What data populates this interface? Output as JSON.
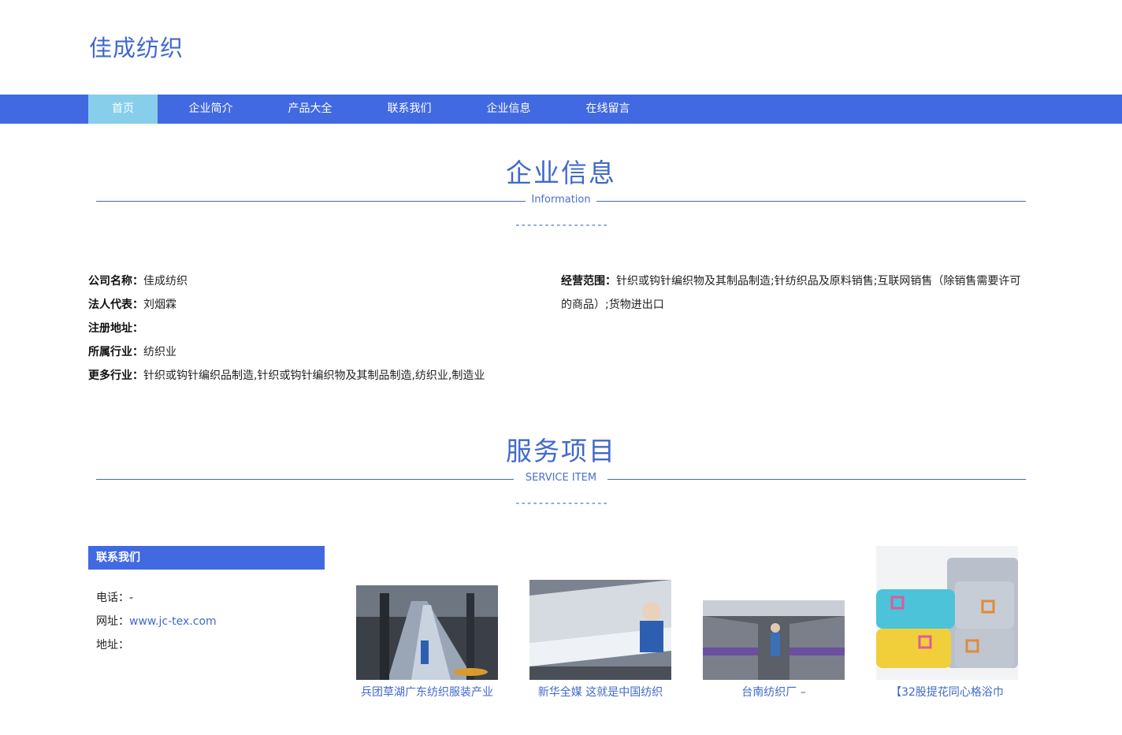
{
  "brand": "佳成纺织",
  "nav": [
    "首页",
    "企业简介",
    "产品大全",
    "联系我们",
    "企业信息",
    "在线留言"
  ],
  "info_section": {
    "title": "企业信息",
    "subtitle": "Information",
    "dashes": "----------------"
  },
  "company": {
    "left": [
      {
        "label": "公司名称：",
        "value": "佳成纺织"
      },
      {
        "label": "法人代表：",
        "value": "刘烟霖"
      },
      {
        "label": "注册地址：",
        "value": ""
      },
      {
        "label": "所属行业：",
        "value": "纺织业"
      },
      {
        "label": "更多行业：",
        "value": "针织或钩针编织品制造,针织或钩针编织物及其制品制造,纺织业,制造业"
      }
    ],
    "scope_label": "经营范围：",
    "scope_value": "针织或钩针编织物及其制品制造;针纺织品及原料销售;互联网销售（除销售需要许可的商品）;货物进出口"
  },
  "service_section": {
    "title": "服务项目",
    "subtitle": "SERVICE ITEM",
    "dashes": "----------------"
  },
  "contact": {
    "heading": "联系我们",
    "phone_label": "电话：",
    "phone": "-",
    "site_label": "网址：",
    "site": "www.jc-tex.com",
    "address_label": "地址：",
    "address": ""
  },
  "services": [
    {
      "caption": "兵团草湖广东纺织服装产业"
    },
    {
      "caption": "新华全媒 这就是中国纺织"
    },
    {
      "caption": "台南纺织厂 –"
    },
    {
      "caption": "【32股提花同心格浴巾"
    }
  ],
  "colors": {
    "accent": "#4169e1",
    "nav_active": "#87ceeb",
    "title": "#4169c9"
  }
}
